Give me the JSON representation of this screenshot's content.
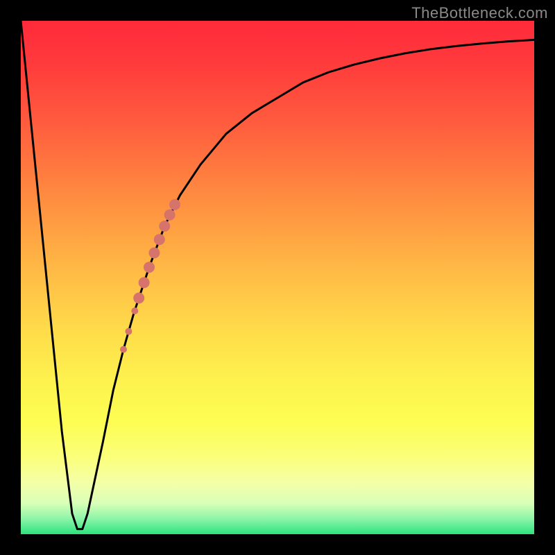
{
  "watermark": "TheBottleneck.com",
  "chart_data": {
    "type": "line",
    "title": "",
    "xlabel": "",
    "ylabel": "",
    "xlim": [
      0,
      100
    ],
    "ylim": [
      0,
      100
    ],
    "grid": false,
    "series": [
      {
        "name": "bottleneck-curve",
        "x": [
          0,
          2,
          4,
          6,
          8,
          10,
          11,
          12,
          13,
          16,
          18,
          20,
          22,
          25,
          28,
          31,
          35,
          40,
          45,
          50,
          55,
          60,
          65,
          70,
          75,
          80,
          85,
          90,
          95,
          100
        ],
        "y": [
          100,
          80,
          60,
          40,
          20,
          4,
          1,
          1,
          4,
          18,
          28,
          36,
          43,
          52,
          60,
          66,
          72,
          78,
          82,
          85,
          88,
          90,
          91.5,
          92.7,
          93.7,
          94.5,
          95.1,
          95.6,
          96,
          96.3
        ]
      }
    ],
    "highlight_points": {
      "name": "highlight-segment",
      "color": "#d6746c",
      "points": [
        {
          "x": 20.0,
          "y": 36.0,
          "r": 5
        },
        {
          "x": 21.0,
          "y": 39.5,
          "r": 5
        },
        {
          "x": 22.2,
          "y": 43.5,
          "r": 5
        },
        {
          "x": 23.0,
          "y": 46.0,
          "r": 8
        },
        {
          "x": 24.0,
          "y": 49.0,
          "r": 8
        },
        {
          "x": 25.0,
          "y": 52.0,
          "r": 8
        },
        {
          "x": 26.0,
          "y": 54.8,
          "r": 8
        },
        {
          "x": 27.0,
          "y": 57.4,
          "r": 8
        },
        {
          "x": 28.0,
          "y": 60.0,
          "r": 8
        },
        {
          "x": 29.0,
          "y": 62.2,
          "r": 8
        },
        {
          "x": 30.0,
          "y": 64.2,
          "r": 8
        }
      ]
    },
    "background_gradient": {
      "top_color": "#ff2a3a",
      "mid_color": "#ffdb4a",
      "bottom_color": "#2ee37e"
    }
  }
}
